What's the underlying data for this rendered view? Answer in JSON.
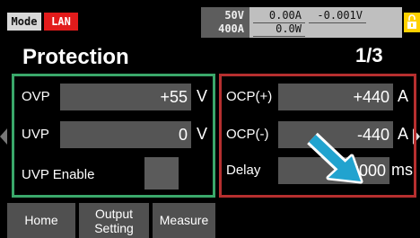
{
  "status_bar": {
    "mode_label": "Mode",
    "interface_label": "LAN",
    "rated_voltage": "50V",
    "rated_current": "400A",
    "current_readout": "0.00A",
    "voltage_readout": "-0.001V",
    "power_readout": "0.0W"
  },
  "page": {
    "title": "Protection",
    "indicator": "1/3"
  },
  "left_panel": {
    "ovp": {
      "label": "OVP",
      "value": "+55",
      "unit": "V"
    },
    "uvp": {
      "label": "UVP",
      "value": "0",
      "unit": "V"
    },
    "uvp_enable": {
      "label": "UVP Enable",
      "checked": false
    }
  },
  "right_panel": {
    "ocp_plus": {
      "label": "OCP(+)",
      "value": "+440",
      "unit": "A"
    },
    "ocp_minus": {
      "label": "OCP(-)",
      "value": "-440",
      "unit": "A"
    },
    "delay": {
      "label": "Delay",
      "value": "2000",
      "unit": "ms"
    }
  },
  "soft_keys": {
    "home": "Home",
    "output_line1": "Output",
    "output_line2": "Setting",
    "measure": "Measure"
  },
  "colors": {
    "left_panel_border": "#3aa86a",
    "right_panel_border": "#b62f2f",
    "lan_chip": "#e21b1b",
    "lock_button": "#ffd100",
    "pointer_arrow": "#21a3cf"
  },
  "icons": {
    "lock": "lock-icon",
    "pointer": "arrow-pointer-icon",
    "prev_page": "chevron-left-icon",
    "next_page": "chevron-right-icon"
  }
}
